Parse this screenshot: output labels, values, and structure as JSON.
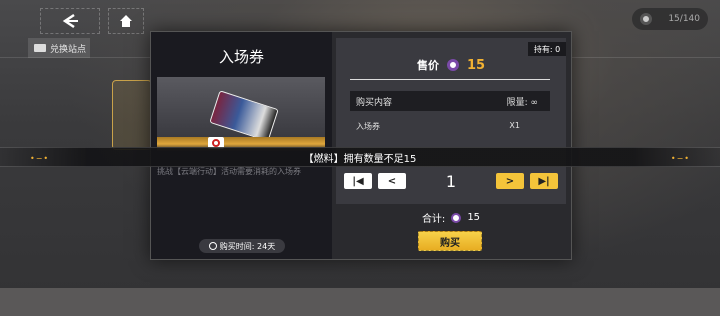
{
  "header": {
    "station_tab_label": "兑换站点",
    "counter_text": "15/140"
  },
  "dialog": {
    "title": "入场券",
    "description": "挑战【云端行动】活动需要消耗的入场券",
    "purchase_time": "购买时间: 24天",
    "own_label": "持有: 0",
    "price_label": "售价",
    "price_value": "15",
    "table_header_left": "购买内容",
    "table_header_right": "限量: ∞",
    "item_name": "入场券",
    "item_qty": "X1",
    "quantity": "1",
    "total_label": "合计:",
    "total_value": "15",
    "buy_label": "购买"
  },
  "toast": {
    "message": "【燃料】拥有数量不足15"
  },
  "colors": {
    "accent_gold": "#f2b233",
    "coin_purple": "#7a4aa8"
  }
}
